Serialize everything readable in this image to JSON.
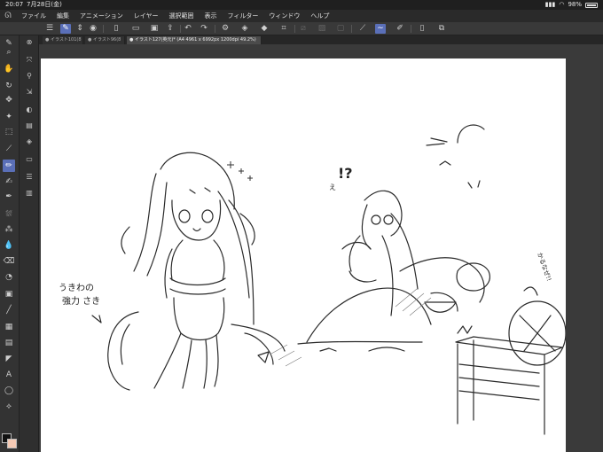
{
  "status": {
    "time": "20:07",
    "date": "7月28日(金)",
    "battery": "98%"
  },
  "menu": {
    "items": [
      "ファイル",
      "編集",
      "アニメーション",
      "レイヤー",
      "選択範囲",
      "表示",
      "フィルター",
      "ウィンドウ",
      "ヘルプ"
    ]
  },
  "tabs": [
    {
      "label": "● イラスト101(8"
    },
    {
      "label": "● イラスト96(8"
    },
    {
      "label": "● イラスト127(英元)* (A4 4961 x 6992px 1200dpi 49.2%)"
    }
  ],
  "colors": {
    "accent": "#5a6fb8",
    "foreground": "#111111",
    "background": "#f4c9b4"
  },
  "drawing": {
    "note_line1": "うきわの",
    "note_line2": "強力 さき",
    "exclaim": "!?",
    "exclaim_small": "え",
    "side_text": "かるなぜ!!"
  }
}
